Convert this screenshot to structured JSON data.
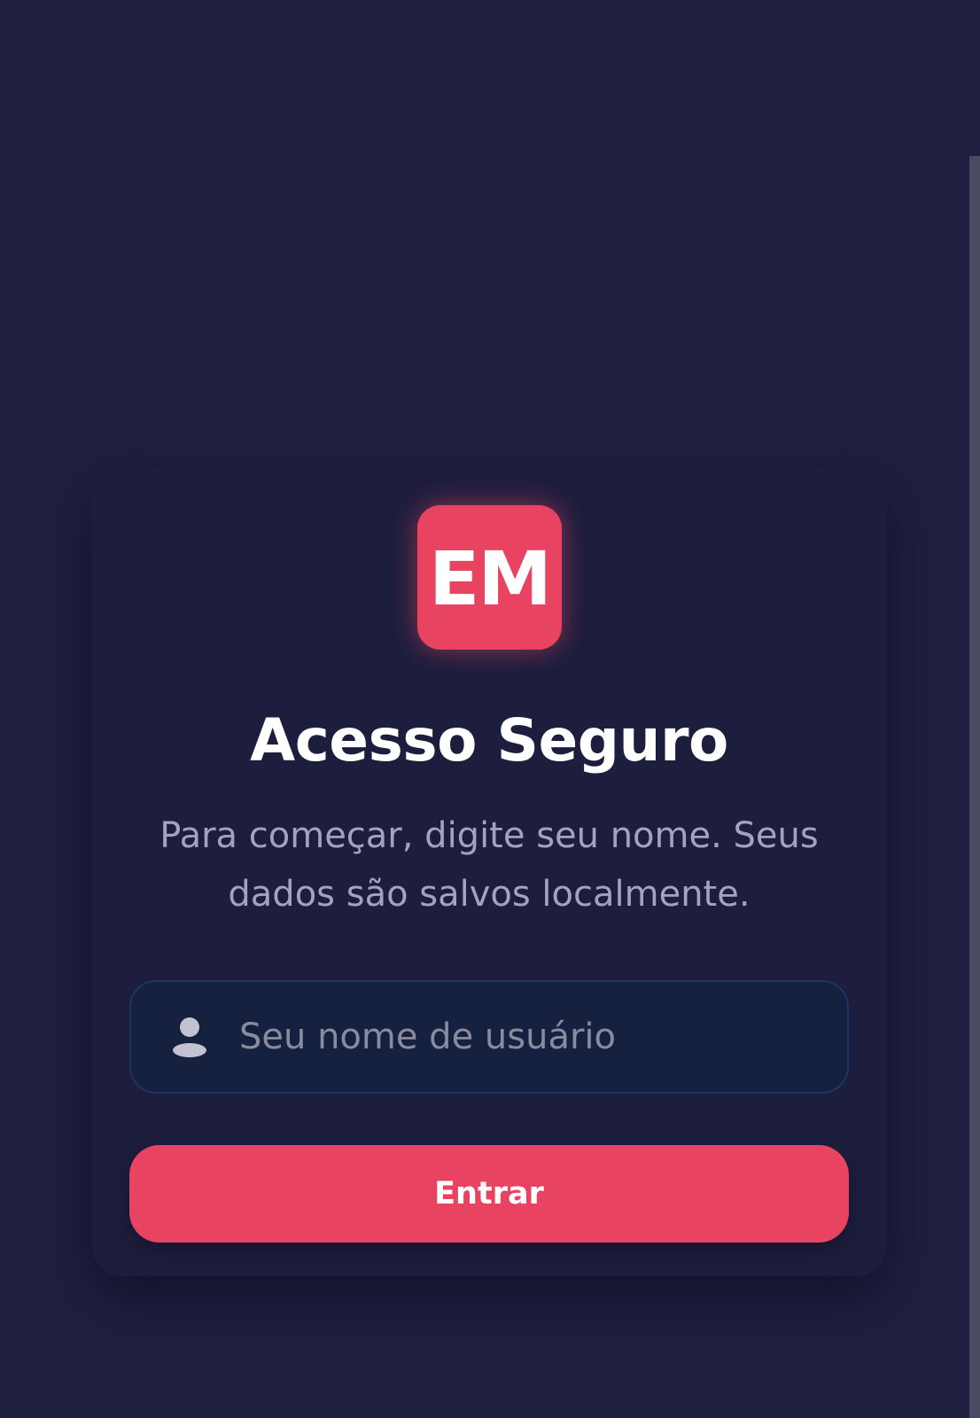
{
  "colors": {
    "background": "#1f1f40",
    "card": "#1d1d3d",
    "accent": "#e84462",
    "input_background": "#16213f",
    "input_border": "#1e3366",
    "subtitle_text": "#a3a3bd",
    "placeholder_text": "#8b8b9e"
  },
  "logo": {
    "text": "EM"
  },
  "login": {
    "title": "Acesso Seguro",
    "subtitle": "Para começar, digite seu nome. Seus dados são salvos localmente.",
    "username": {
      "icon": "user-icon",
      "value": "",
      "placeholder": "Seu nome de usuário"
    },
    "submit_label": "Entrar"
  }
}
